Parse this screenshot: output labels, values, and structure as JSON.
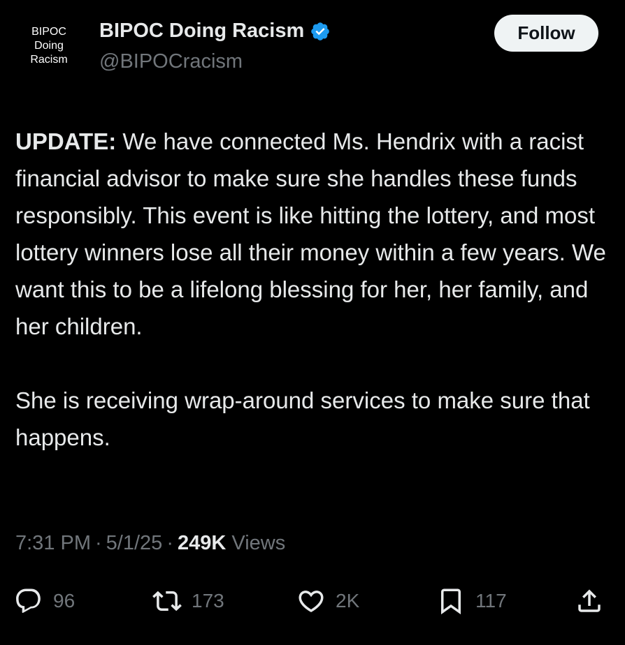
{
  "author": {
    "avatar_lines": [
      "BIPOC",
      "Doing",
      "Racism"
    ],
    "display_name": "BIPOC Doing Racism",
    "handle": "@BIPOCracism",
    "verified_color": "#1d9bf0"
  },
  "follow_label": "Follow",
  "tweet": {
    "lead_bold": "UPDATE:",
    "paragraph1_rest": " We have connected Ms. Hendrix with a racist financial advisor to make sure she handles these funds responsibly. This event is like hitting the lottery, and most lottery winners lose all their money within a few years. We want this to be a lifelong blessing for her, her family, and her children.",
    "paragraph2": "She is receiving wrap-around services to make sure that happens."
  },
  "meta": {
    "time": "7:31 PM",
    "date": "5/1/25",
    "views_count": "249K",
    "views_label": "Views",
    "separator": "·"
  },
  "actions": {
    "replies": "96",
    "reposts": "173",
    "likes": "2K",
    "bookmarks": "117"
  },
  "icons": [
    "reply-icon",
    "repost-icon",
    "like-icon",
    "bookmark-icon",
    "share-icon",
    "verified-badge-icon"
  ]
}
